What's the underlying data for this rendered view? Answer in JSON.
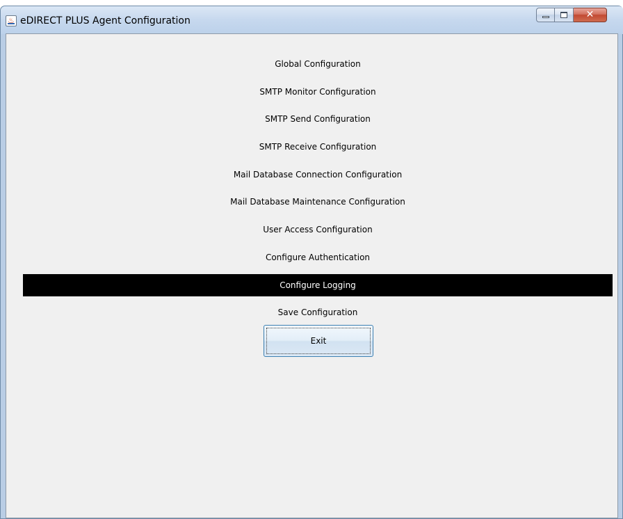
{
  "window": {
    "title": "eDIRECT PLUS Agent Configuration",
    "icon": "java-app-icon",
    "controls": {
      "minimize": "minimize-icon",
      "maximize": "maximize-icon",
      "close": "✕"
    }
  },
  "menu": {
    "items": [
      {
        "label": "Global Configuration"
      },
      {
        "label": "SMTP Monitor Configuration"
      },
      {
        "label": "SMTP Send Configuration"
      },
      {
        "label": "SMTP Receive Configuration"
      },
      {
        "label": "Mail Database Connection Configuration"
      },
      {
        "label": "Mail Database Maintenance Configuration"
      },
      {
        "label": "User Access Configuration"
      },
      {
        "label": "Configure Authentication"
      },
      {
        "label": "Configure Logging"
      },
      {
        "label": "Save Configuration"
      }
    ],
    "selected": "Configure Logging",
    "selected_background": "#000000",
    "selected_text_color": "#ffffff"
  },
  "exit_button": {
    "label": "Exit"
  },
  "colors": {
    "client_background": "#f0f0f0",
    "title_bar": "#c6d8ee",
    "close_button": "#c24a33"
  }
}
